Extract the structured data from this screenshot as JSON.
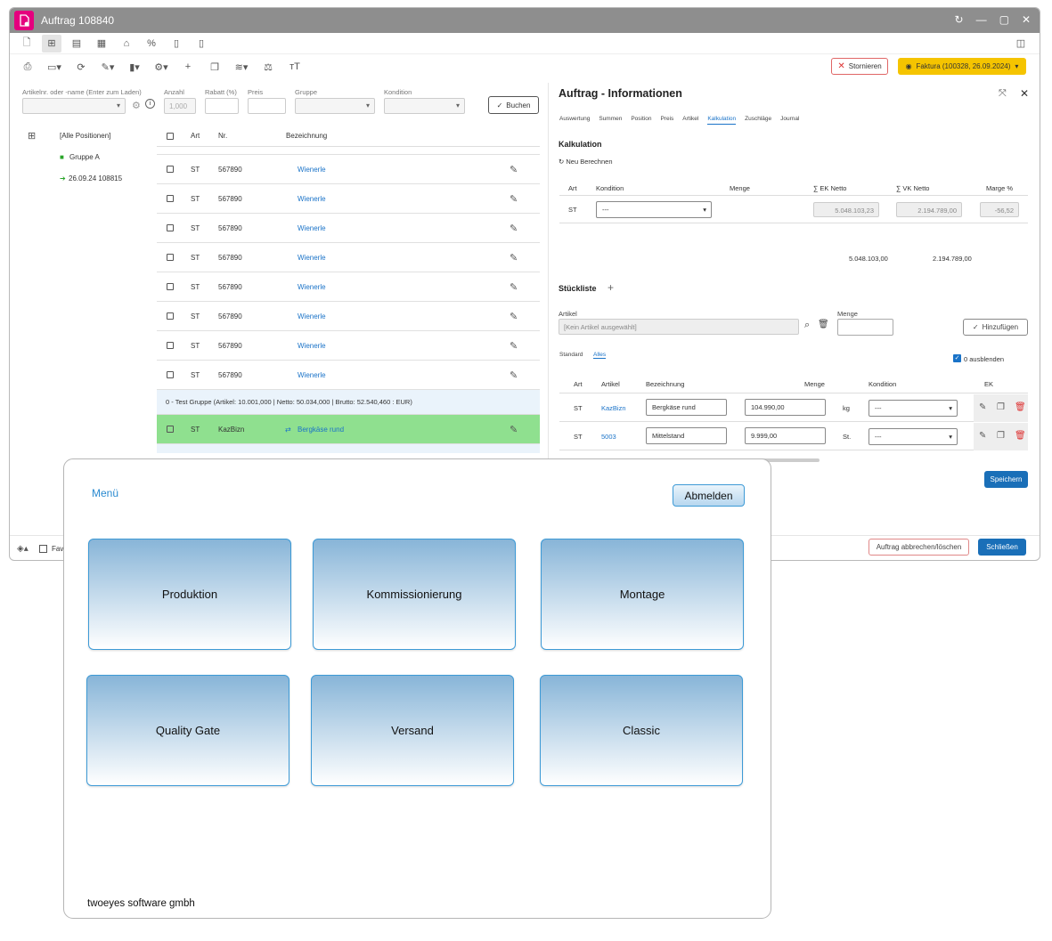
{
  "window": {
    "title": "Auftrag 108840"
  },
  "toolbar": {
    "stornieren_label": "Stornieren",
    "faktura_label": "Faktura (100328, 26.09.2024)"
  },
  "filter": {
    "article_label": "Artikelnr. oder -name (Enter zum Laden)",
    "anzahl_label": "Anzahl",
    "anzahl_placeholder": "1,000",
    "rabatt_label": "Rabatt (%)",
    "preis_label": "Preis",
    "gruppe_label": "Gruppe",
    "kondition_label": "Kondition",
    "buchen_label": "Buchen"
  },
  "tree": {
    "all_positions": "[Alle Positionen]",
    "group_a": "Gruppe A",
    "order_ref": "26.09.24 108815"
  },
  "positions": {
    "headers": {
      "art": "Art",
      "nr": "Nr.",
      "bez": "Bezeichnung"
    },
    "rows": [
      {
        "art": "ST",
        "nr": "567890",
        "bez": "Wienerle"
      },
      {
        "art": "ST",
        "nr": "567890",
        "bez": "Wienerle"
      },
      {
        "art": "ST",
        "nr": "567890",
        "bez": "Wienerle"
      },
      {
        "art": "ST",
        "nr": "567890",
        "bez": "Wienerle"
      },
      {
        "art": "ST",
        "nr": "567890",
        "bez": "Wienerle"
      },
      {
        "art": "ST",
        "nr": "567890",
        "bez": "Wienerle"
      },
      {
        "art": "ST",
        "nr": "567890",
        "bez": "Wienerle"
      },
      {
        "art": "ST",
        "nr": "567890",
        "bez": "Wienerle"
      }
    ],
    "group_row": "0 - Test Gruppe (Artikel: 10.001,000 | Netto: 50.034,000 | Brutto: 52.540,460 : EUR)",
    "highlight_row": {
      "art": "ST",
      "nr": "KazBizn",
      "bez": "Bergkäse rund"
    }
  },
  "info": {
    "title": "Auftrag - Informationen",
    "tabs": [
      "Auswertung",
      "Summen",
      "Position",
      "Preis",
      "Artikel",
      "Kalkulation",
      "Zuschläge",
      "Journal"
    ],
    "kalkulation": {
      "title": "Kalkulation",
      "recalc": "Neu Berechnen",
      "headers": {
        "art": "Art",
        "kondition": "Kondition",
        "menge": "Menge",
        "ek": "∑ EK Netto",
        "vk": "∑ VK Netto",
        "marge": "Marge %"
      },
      "row": {
        "art": "ST",
        "kondition": "---",
        "ek": "5.048.103,23",
        "vk": "2.194.789,00",
        "marge": "-56,52"
      },
      "totals": {
        "ek": "5.048.103,00",
        "vk": "2.194.789,00"
      }
    },
    "stueckliste": {
      "title": "Stückliste",
      "artikel_label": "Artikel",
      "artikel_placeholder": "[Kein Artikel ausgewählt]",
      "menge_label": "Menge",
      "add_label": "Hinzufügen",
      "subtabs": [
        "Standard",
        "Alles"
      ],
      "hide_label": "0 ausblenden",
      "headers": {
        "art": "Art",
        "artikel": "Artikel",
        "bez": "Bezeichnung",
        "menge": "Menge",
        "kondition": "Kondition",
        "ek": "EK"
      },
      "rows": [
        {
          "art": "ST",
          "artikel": "KazBizn",
          "bez": "Bergkäse rund",
          "menge": "104.990,00",
          "unit": "kg",
          "kondition": "---"
        },
        {
          "art": "ST",
          "artikel": "5003",
          "bez": "Mittelstand",
          "menge": "9.999,00",
          "unit": "St.",
          "kondition": "---"
        }
      ],
      "save_label": "Speichern"
    }
  },
  "status": {
    "fav_label": "Fav",
    "cancel_delete_label": "Auftrag abbrechen/löschen",
    "close_label": "Schließen"
  },
  "menu": {
    "title": "Menü",
    "logout_label": "Abmelden",
    "tiles": [
      "Produktion",
      "Kommissionierung",
      "Montage",
      "Quality Gate",
      "Versand",
      "Classic"
    ],
    "footer": "twoeyes software gmbh"
  }
}
